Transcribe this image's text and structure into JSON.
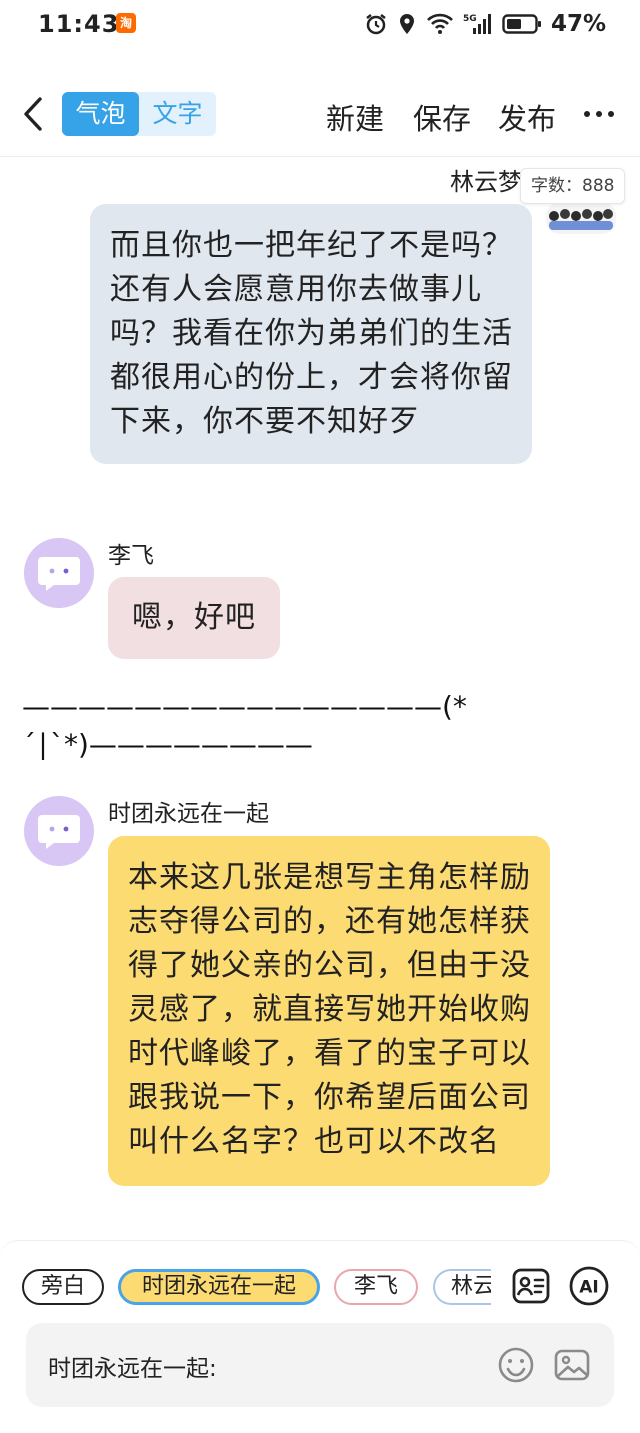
{
  "status_bar": {
    "time": "11:43",
    "app_badge": "淘",
    "signal_label": "5G",
    "battery": "47%"
  },
  "toolbar": {
    "mode_bubble": "气泡",
    "mode_text": "文字",
    "new": "新建",
    "save": "保存",
    "publish": "发布"
  },
  "messages": [
    {
      "sender": "林云梦",
      "side": "right",
      "text": "而且你也一把年纪了不是吗？还有人会愿意用你去做事儿吗？我看在你为弟弟们的生活都很用心的份上，才会将你留下来，你不要不知好歹"
    },
    {
      "sender": "李飞",
      "side": "left",
      "text": "嗯，好吧"
    },
    {
      "sender": "时团永远在一起",
      "side": "left",
      "text": "本来这几张是想写主角怎样励志夺得公司的，还有她怎样获得了她父亲的公司，但由于没灵感了，就直接写她开始收购时代峰峻了，看了的宝子可以跟我说一下，你希望后面公司叫什么名字？也可以不改名"
    }
  ],
  "word_count": "字数：888",
  "narration": "———————————————(*´∣`*)————————",
  "composer": {
    "chips": [
      "旁白",
      "时团永远在一起",
      "李飞",
      "林云"
    ],
    "ai_label": "AI",
    "input_prefix": "时团永远在一起:"
  },
  "colors": {
    "accent_blue": "#36a3e8",
    "bubble_right": "#e1e7ef",
    "bubble_lifei": "#f1dfe1",
    "bubble_yellow": "#fddb73",
    "avatar_purple": "#d8c6f5"
  },
  "icons": {
    "back": "chevron-left-icon",
    "more": "more-dots-icon",
    "card": "character-card-icon",
    "emoji": "emoji-icon",
    "image": "image-icon"
  }
}
